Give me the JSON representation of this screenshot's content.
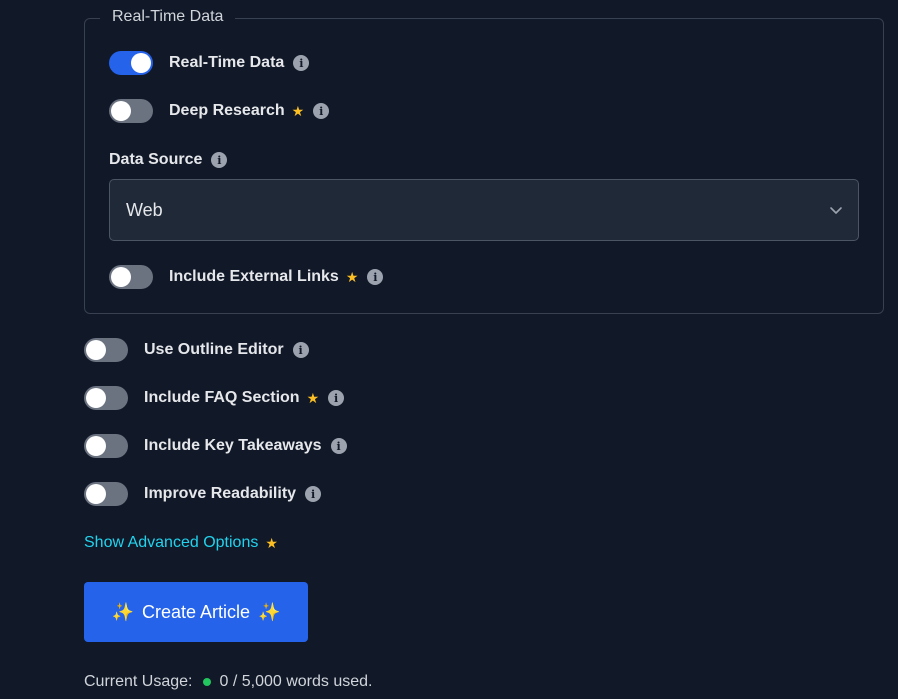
{
  "realtime_group": {
    "legend": "Real-Time Data",
    "toggles": [
      {
        "label": "Real-Time Data",
        "on": true,
        "star": false
      },
      {
        "label": "Deep Research",
        "on": false,
        "star": true
      }
    ],
    "data_source": {
      "label": "Data Source",
      "selected": "Web"
    },
    "external_links": {
      "label": "Include External Links",
      "on": false,
      "star": true
    }
  },
  "options": [
    {
      "label": "Use Outline Editor",
      "on": false,
      "star": false
    },
    {
      "label": "Include FAQ Section",
      "on": false,
      "star": true
    },
    {
      "label": "Include Key Takeaways",
      "on": false,
      "star": false
    },
    {
      "label": "Improve Readability",
      "on": false,
      "star": false
    }
  ],
  "advanced": {
    "label": "Show Advanced Options"
  },
  "create_button": {
    "label": "Create Article",
    "icon": "sparkles"
  },
  "usage": {
    "prefix": "Current Usage:",
    "value": "0 / 5,000 words used."
  },
  "colors": {
    "background": "#111827",
    "accent": "#2563eb",
    "link": "#22d3ee",
    "star": "#fbbf24",
    "status_ok": "#22c55e"
  },
  "icons": {
    "info": "info-icon",
    "star": "star-icon",
    "chevron": "chevron-down-icon"
  }
}
